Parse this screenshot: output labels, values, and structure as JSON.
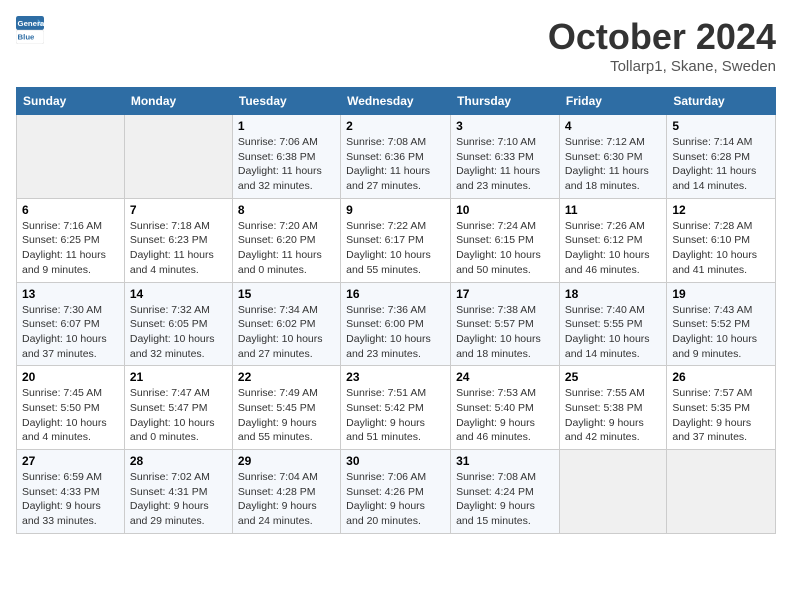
{
  "header": {
    "logo_line1": "General",
    "logo_line2": "Blue",
    "title": "October 2024",
    "subtitle": "Tollarp1, Skane, Sweden"
  },
  "weekdays": [
    "Sunday",
    "Monday",
    "Tuesday",
    "Wednesday",
    "Thursday",
    "Friday",
    "Saturday"
  ],
  "weeks": [
    [
      {
        "day": "",
        "sunrise": "",
        "sunset": "",
        "daylight": ""
      },
      {
        "day": "",
        "sunrise": "",
        "sunset": "",
        "daylight": ""
      },
      {
        "day": "1",
        "sunrise": "Sunrise: 7:06 AM",
        "sunset": "Sunset: 6:38 PM",
        "daylight": "Daylight: 11 hours and 32 minutes."
      },
      {
        "day": "2",
        "sunrise": "Sunrise: 7:08 AM",
        "sunset": "Sunset: 6:36 PM",
        "daylight": "Daylight: 11 hours and 27 minutes."
      },
      {
        "day": "3",
        "sunrise": "Sunrise: 7:10 AM",
        "sunset": "Sunset: 6:33 PM",
        "daylight": "Daylight: 11 hours and 23 minutes."
      },
      {
        "day": "4",
        "sunrise": "Sunrise: 7:12 AM",
        "sunset": "Sunset: 6:30 PM",
        "daylight": "Daylight: 11 hours and 18 minutes."
      },
      {
        "day": "5",
        "sunrise": "Sunrise: 7:14 AM",
        "sunset": "Sunset: 6:28 PM",
        "daylight": "Daylight: 11 hours and 14 minutes."
      }
    ],
    [
      {
        "day": "6",
        "sunrise": "Sunrise: 7:16 AM",
        "sunset": "Sunset: 6:25 PM",
        "daylight": "Daylight: 11 hours and 9 minutes."
      },
      {
        "day": "7",
        "sunrise": "Sunrise: 7:18 AM",
        "sunset": "Sunset: 6:23 PM",
        "daylight": "Daylight: 11 hours and 4 minutes."
      },
      {
        "day": "8",
        "sunrise": "Sunrise: 7:20 AM",
        "sunset": "Sunset: 6:20 PM",
        "daylight": "Daylight: 11 hours and 0 minutes."
      },
      {
        "day": "9",
        "sunrise": "Sunrise: 7:22 AM",
        "sunset": "Sunset: 6:17 PM",
        "daylight": "Daylight: 10 hours and 55 minutes."
      },
      {
        "day": "10",
        "sunrise": "Sunrise: 7:24 AM",
        "sunset": "Sunset: 6:15 PM",
        "daylight": "Daylight: 10 hours and 50 minutes."
      },
      {
        "day": "11",
        "sunrise": "Sunrise: 7:26 AM",
        "sunset": "Sunset: 6:12 PM",
        "daylight": "Daylight: 10 hours and 46 minutes."
      },
      {
        "day": "12",
        "sunrise": "Sunrise: 7:28 AM",
        "sunset": "Sunset: 6:10 PM",
        "daylight": "Daylight: 10 hours and 41 minutes."
      }
    ],
    [
      {
        "day": "13",
        "sunrise": "Sunrise: 7:30 AM",
        "sunset": "Sunset: 6:07 PM",
        "daylight": "Daylight: 10 hours and 37 minutes."
      },
      {
        "day": "14",
        "sunrise": "Sunrise: 7:32 AM",
        "sunset": "Sunset: 6:05 PM",
        "daylight": "Daylight: 10 hours and 32 minutes."
      },
      {
        "day": "15",
        "sunrise": "Sunrise: 7:34 AM",
        "sunset": "Sunset: 6:02 PM",
        "daylight": "Daylight: 10 hours and 27 minutes."
      },
      {
        "day": "16",
        "sunrise": "Sunrise: 7:36 AM",
        "sunset": "Sunset: 6:00 PM",
        "daylight": "Daylight: 10 hours and 23 minutes."
      },
      {
        "day": "17",
        "sunrise": "Sunrise: 7:38 AM",
        "sunset": "Sunset: 5:57 PM",
        "daylight": "Daylight: 10 hours and 18 minutes."
      },
      {
        "day": "18",
        "sunrise": "Sunrise: 7:40 AM",
        "sunset": "Sunset: 5:55 PM",
        "daylight": "Daylight: 10 hours and 14 minutes."
      },
      {
        "day": "19",
        "sunrise": "Sunrise: 7:43 AM",
        "sunset": "Sunset: 5:52 PM",
        "daylight": "Daylight: 10 hours and 9 minutes."
      }
    ],
    [
      {
        "day": "20",
        "sunrise": "Sunrise: 7:45 AM",
        "sunset": "Sunset: 5:50 PM",
        "daylight": "Daylight: 10 hours and 4 minutes."
      },
      {
        "day": "21",
        "sunrise": "Sunrise: 7:47 AM",
        "sunset": "Sunset: 5:47 PM",
        "daylight": "Daylight: 10 hours and 0 minutes."
      },
      {
        "day": "22",
        "sunrise": "Sunrise: 7:49 AM",
        "sunset": "Sunset: 5:45 PM",
        "daylight": "Daylight: 9 hours and 55 minutes."
      },
      {
        "day": "23",
        "sunrise": "Sunrise: 7:51 AM",
        "sunset": "Sunset: 5:42 PM",
        "daylight": "Daylight: 9 hours and 51 minutes."
      },
      {
        "day": "24",
        "sunrise": "Sunrise: 7:53 AM",
        "sunset": "Sunset: 5:40 PM",
        "daylight": "Daylight: 9 hours and 46 minutes."
      },
      {
        "day": "25",
        "sunrise": "Sunrise: 7:55 AM",
        "sunset": "Sunset: 5:38 PM",
        "daylight": "Daylight: 9 hours and 42 minutes."
      },
      {
        "day": "26",
        "sunrise": "Sunrise: 7:57 AM",
        "sunset": "Sunset: 5:35 PM",
        "daylight": "Daylight: 9 hours and 37 minutes."
      }
    ],
    [
      {
        "day": "27",
        "sunrise": "Sunrise: 6:59 AM",
        "sunset": "Sunset: 4:33 PM",
        "daylight": "Daylight: 9 hours and 33 minutes."
      },
      {
        "day": "28",
        "sunrise": "Sunrise: 7:02 AM",
        "sunset": "Sunset: 4:31 PM",
        "daylight": "Daylight: 9 hours and 29 minutes."
      },
      {
        "day": "29",
        "sunrise": "Sunrise: 7:04 AM",
        "sunset": "Sunset: 4:28 PM",
        "daylight": "Daylight: 9 hours and 24 minutes."
      },
      {
        "day": "30",
        "sunrise": "Sunrise: 7:06 AM",
        "sunset": "Sunset: 4:26 PM",
        "daylight": "Daylight: 9 hours and 20 minutes."
      },
      {
        "day": "31",
        "sunrise": "Sunrise: 7:08 AM",
        "sunset": "Sunset: 4:24 PM",
        "daylight": "Daylight: 9 hours and 15 minutes."
      },
      {
        "day": "",
        "sunrise": "",
        "sunset": "",
        "daylight": ""
      },
      {
        "day": "",
        "sunrise": "",
        "sunset": "",
        "daylight": ""
      }
    ]
  ]
}
